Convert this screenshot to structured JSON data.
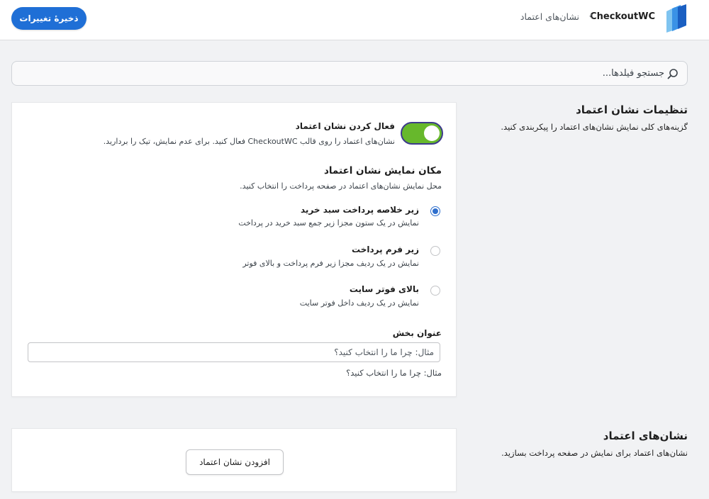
{
  "header": {
    "brand": "CheckoutWC",
    "breadcrumb": "نشان‌های اعتماد",
    "save_label": "ذخیرهٔ تغییرات"
  },
  "search": {
    "placeholder": "جستجو فیلدها..."
  },
  "settings_section": {
    "title": "تنظیمات نشان اعتماد",
    "description": "گزینه‌های کلی نمایش نشان‌های اعتماد را پیکربندی کنید.",
    "enable": {
      "label": "فعال کردن نشان اعتماد",
      "description": "نشان‌های اعتماد را روی قالب CheckoutWC فعال کنید. برای عدم نمایش، تیک را بردارید.",
      "enabled": true
    },
    "position": {
      "title": "مکان نمایش نشان اعتماد",
      "description": "محل نمایش نشان‌های اعتماد در صفحه پرداخت را انتخاب کنید.",
      "options": [
        {
          "label": "زیر خلاصه پرداخت سبد خرید",
          "description": "نمایش در یک ستون مجزا زیر جمع سبد خرید در پرداخت",
          "selected": true
        },
        {
          "label": "زیر فرم پرداخت",
          "description": "نمایش در یک ردیف مجزا زیر فرم پرداخت و بالای فوتر",
          "selected": false
        },
        {
          "label": "بالای فوتر سایت",
          "description": "نمایش در یک ردیف داخل فوتر سایت",
          "selected": false
        }
      ]
    },
    "section_title": {
      "label": "عنوان بخش",
      "placeholder": "مثال: چرا ما را انتخاب کنید؟",
      "help": "مثال: چرا ما را انتخاب کنید؟"
    }
  },
  "badges_section": {
    "title": "نشان‌های اعتماد",
    "description": "نشان‌های اعتماد برای نمایش در صفحه پرداخت بسازید.",
    "add_label": "افزودن نشان اعتماد"
  },
  "colors": {
    "primary": "#1f6fd6",
    "toggle_on": "#67b82c",
    "toggle_border": "#3d3a8c",
    "radio_checked": "#2f6fcd"
  }
}
